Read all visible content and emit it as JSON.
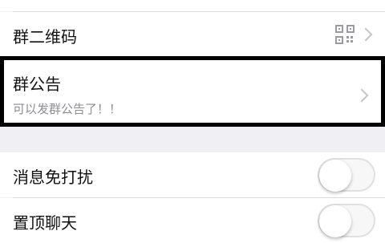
{
  "rows": [
    {
      "label": "群二维码"
    },
    {
      "label": "群公告",
      "sublabel": "可以发群公告了！！"
    },
    {
      "label": "消息免打扰",
      "toggle": false
    },
    {
      "label": "置顶聊天",
      "toggle": false
    }
  ],
  "icons": {
    "qr": "qr-code-icon",
    "chevron": "chevron-right-icon"
  },
  "colors": {
    "background": "#efeff4",
    "highlight_border": "#000000"
  }
}
